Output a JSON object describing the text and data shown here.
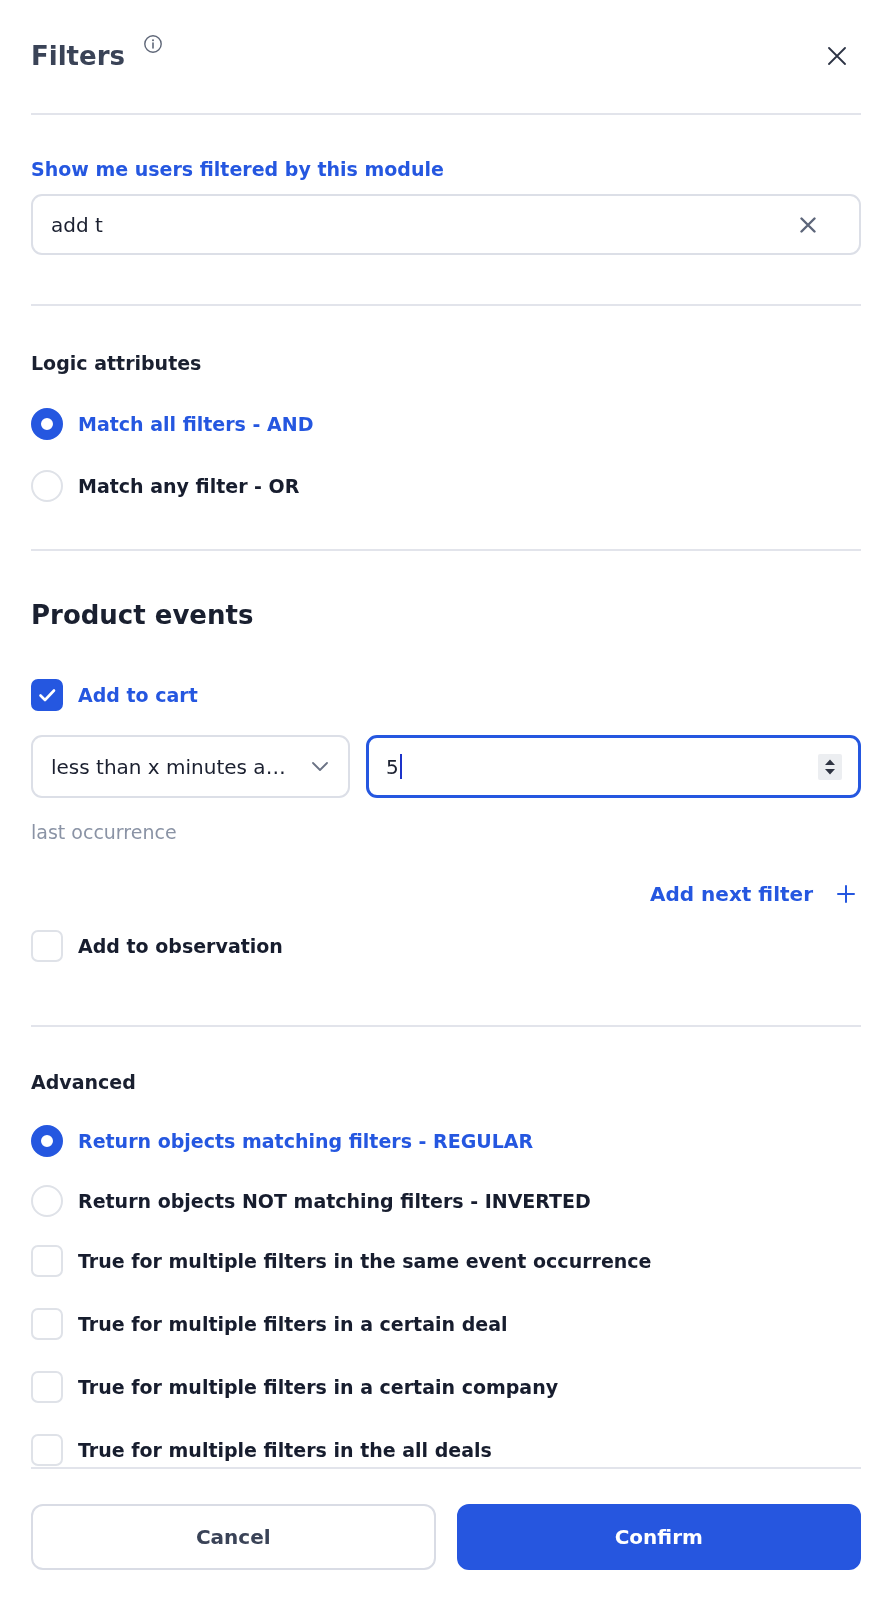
{
  "header": {
    "title": "Filters"
  },
  "module_filter": {
    "label": "Show me users filtered by this module",
    "value": "add t"
  },
  "logic": {
    "title": "Logic attributes",
    "options": [
      {
        "label": "Match all filters - AND",
        "selected": true
      },
      {
        "label": "Match any filter - OR",
        "selected": false
      }
    ]
  },
  "product_events": {
    "title": "Product events",
    "events": [
      {
        "label": "Add to cart",
        "checked": true,
        "condition": {
          "operator": "less than x minutes a…",
          "value": "5",
          "focused": true,
          "helper_text": "last occurrence"
        },
        "add_filter": "Add next filter"
      },
      {
        "label": "Add to observation",
        "checked": false
      }
    ]
  },
  "advanced": {
    "title": "Advanced",
    "options": [
      {
        "kind": "radio",
        "label": "Return objects matching filters - REGULAR",
        "selected": true
      },
      {
        "kind": "radio",
        "label": "Return objects NOT matching filters - INVERTED",
        "selected": false
      },
      {
        "kind": "checkbox",
        "label": "True for multiple filters in the same event occurrence",
        "checked": false
      },
      {
        "kind": "checkbox",
        "label": "True for multiple filters in a certain deal",
        "checked": false
      },
      {
        "kind": "checkbox",
        "label": "True for multiple filters in a certain company",
        "checked": false
      },
      {
        "kind": "checkbox",
        "label": "True for multiple filters in the all deals",
        "checked": false
      }
    ]
  },
  "buttons": [
    {
      "label": "Cancel",
      "kind": "secondary"
    },
    {
      "label": "Confirm",
      "kind": "primary"
    }
  ]
}
